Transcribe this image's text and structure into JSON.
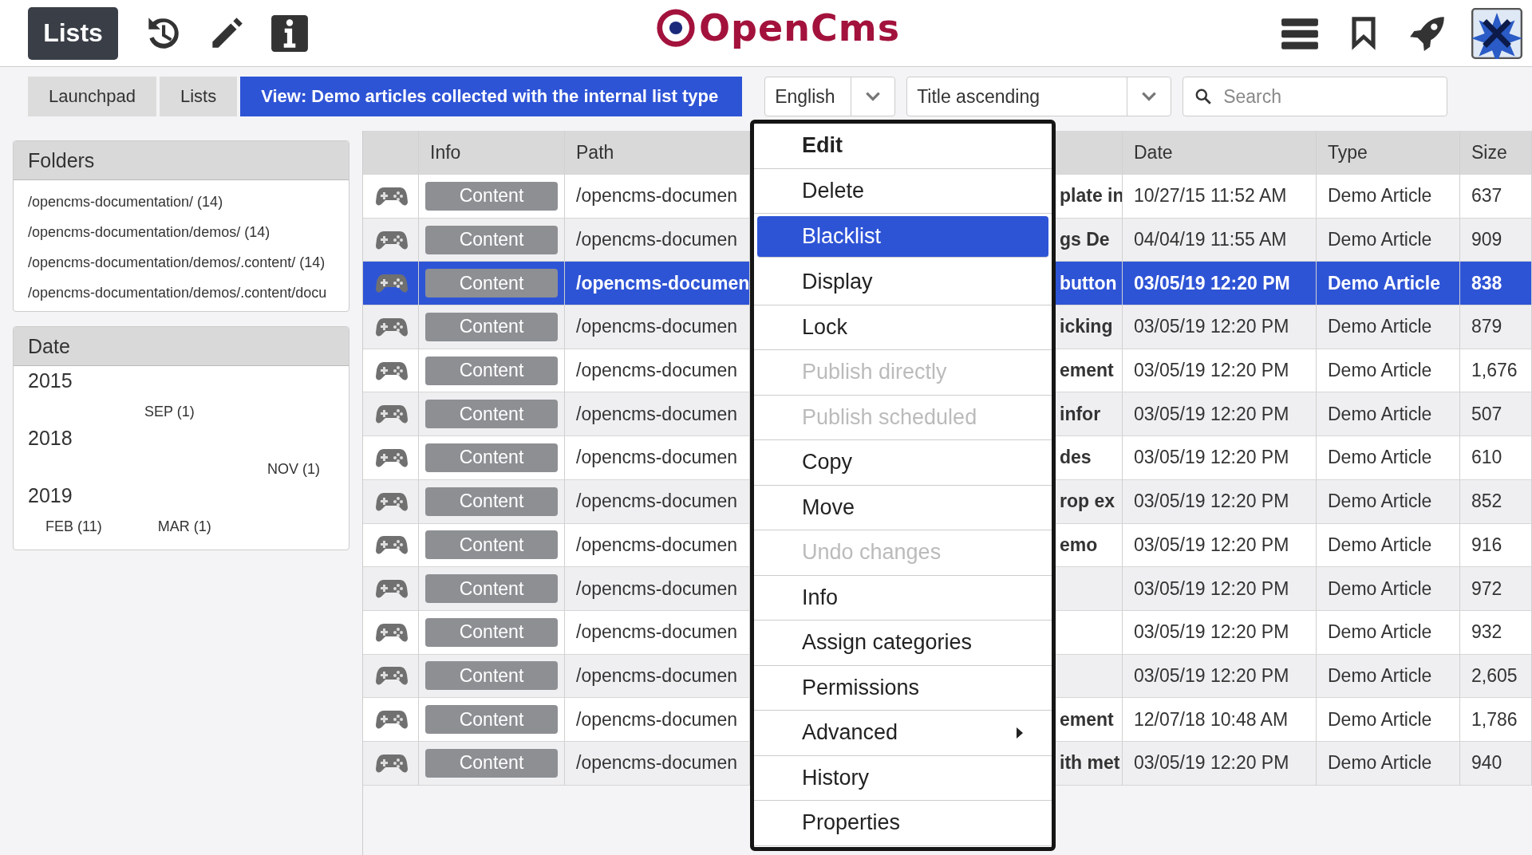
{
  "toolbar": {
    "app_button": "Lists",
    "logo": "OpenCms"
  },
  "breadcrumb": [
    {
      "label": "Launchpad",
      "selected": false
    },
    {
      "label": "Lists",
      "selected": false
    },
    {
      "label": "View: Demo articles collected with the internal list type",
      "selected": true
    }
  ],
  "locale_select": {
    "value": "English"
  },
  "sort_select": {
    "value": "Title ascending"
  },
  "search": {
    "placeholder": "Search"
  },
  "folders": {
    "title": "Folders",
    "items": [
      "/opencms-documentation/ (14)",
      "/opencms-documentation/demos/ (14)",
      "/opencms-documentation/demos/.content/ (14)",
      "/opencms-documentation/demos/.content/docu"
    ]
  },
  "dates": {
    "title": "Date",
    "years": [
      {
        "year": "2015",
        "months": [
          "SEP (1)"
        ]
      },
      {
        "year": "2018",
        "months": [
          "NOV (1)"
        ]
      },
      {
        "year": "2019",
        "months": [
          "FEB (11)",
          "MAR (1)"
        ]
      }
    ]
  },
  "table": {
    "columns": [
      "",
      "Info",
      "Path",
      "",
      "Date",
      "Type",
      "Size"
    ],
    "rows": [
      {
        "info": "Content",
        "path": "/opencms-documen",
        "title": "plate in",
        "date": "10/27/15 11:52 AM",
        "type": "Demo Article",
        "size": "637",
        "selected": false
      },
      {
        "info": "Content",
        "path": "/opencms-documen",
        "title": "gs De",
        "date": "04/04/19 11:55 AM",
        "type": "Demo Article",
        "size": "909",
        "selected": false
      },
      {
        "info": "Content",
        "path": "/opencms-documen",
        "title": "button",
        "date": "03/05/19 12:20 PM",
        "type": "Demo Article",
        "size": "838",
        "selected": true
      },
      {
        "info": "Content",
        "path": "/opencms-documen",
        "title": "icking",
        "date": "03/05/19 12:20 PM",
        "type": "Demo Article",
        "size": "879",
        "selected": false
      },
      {
        "info": "Content",
        "path": "/opencms-documen",
        "title": "ement",
        "date": "03/05/19 12:20 PM",
        "type": "Demo Article",
        "size": "1,676",
        "selected": false
      },
      {
        "info": "Content",
        "path": "/opencms-documen",
        "title": "infor",
        "date": "03/05/19 12:20 PM",
        "type": "Demo Article",
        "size": "507",
        "selected": false
      },
      {
        "info": "Content",
        "path": "/opencms-documen",
        "title": "des",
        "date": "03/05/19 12:20 PM",
        "type": "Demo Article",
        "size": "610",
        "selected": false
      },
      {
        "info": "Content",
        "path": "/opencms-documen",
        "title": "rop ex",
        "date": "03/05/19 12:20 PM",
        "type": "Demo Article",
        "size": "852",
        "selected": false
      },
      {
        "info": "Content",
        "path": "/opencms-documen",
        "title": "emo",
        "date": "03/05/19 12:20 PM",
        "type": "Demo Article",
        "size": "916",
        "selected": false
      },
      {
        "info": "Content",
        "path": "/opencms-documen",
        "title": "",
        "date": "03/05/19 12:20 PM",
        "type": "Demo Article",
        "size": "972",
        "selected": false
      },
      {
        "info": "Content",
        "path": "/opencms-documen",
        "title": "",
        "date": "03/05/19 12:20 PM",
        "type": "Demo Article",
        "size": "932",
        "selected": false
      },
      {
        "info": "Content",
        "path": "/opencms-documen",
        "title": "",
        "date": "03/05/19 12:20 PM",
        "type": "Demo Article",
        "size": "2,605",
        "selected": false
      },
      {
        "info": "Content",
        "path": "/opencms-documen",
        "title": "ement",
        "date": "12/07/18 10:48 AM",
        "type": "Demo Article",
        "size": "1,786",
        "selected": false
      },
      {
        "info": "Content",
        "path": "/opencms-documen",
        "title": "ith met",
        "date": "03/05/19 12:20 PM",
        "type": "Demo Article",
        "size": "940",
        "selected": false
      }
    ]
  },
  "context_menu": [
    {
      "label": "Edit",
      "default": true,
      "disabled": false,
      "selected": false,
      "submenu": false
    },
    {
      "label": "Delete",
      "default": false,
      "disabled": false,
      "selected": false,
      "submenu": false
    },
    {
      "label": "Blacklist",
      "default": false,
      "disabled": false,
      "selected": true,
      "submenu": false
    },
    {
      "label": "Display",
      "default": false,
      "disabled": false,
      "selected": false,
      "submenu": false
    },
    {
      "label": "Lock",
      "default": false,
      "disabled": false,
      "selected": false,
      "submenu": false
    },
    {
      "label": "Publish directly",
      "default": false,
      "disabled": true,
      "selected": false,
      "submenu": false
    },
    {
      "label": "Publish scheduled",
      "default": false,
      "disabled": true,
      "selected": false,
      "submenu": false
    },
    {
      "label": "Copy",
      "default": false,
      "disabled": false,
      "selected": false,
      "submenu": false
    },
    {
      "label": "Move",
      "default": false,
      "disabled": false,
      "selected": false,
      "submenu": false
    },
    {
      "label": "Undo changes",
      "default": false,
      "disabled": true,
      "selected": false,
      "submenu": false
    },
    {
      "label": "Info",
      "default": false,
      "disabled": false,
      "selected": false,
      "submenu": false
    },
    {
      "label": "Assign categories",
      "default": false,
      "disabled": false,
      "selected": false,
      "submenu": false
    },
    {
      "label": "Permissions",
      "default": false,
      "disabled": false,
      "selected": false,
      "submenu": false
    },
    {
      "label": "Advanced",
      "default": false,
      "disabled": false,
      "selected": false,
      "submenu": true
    },
    {
      "label": "History",
      "default": false,
      "disabled": false,
      "selected": false,
      "submenu": false
    },
    {
      "label": "Properties",
      "default": false,
      "disabled": false,
      "selected": false,
      "submenu": false
    }
  ]
}
